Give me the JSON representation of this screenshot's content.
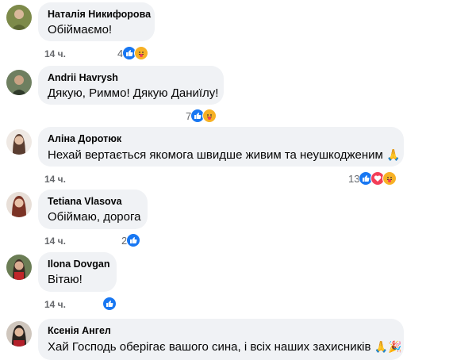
{
  "comments": [
    {
      "author": "Наталія Никифорова",
      "text": "Обіймаємо!",
      "time": "14 ч.",
      "reactions": "4",
      "avatar_color": "#9a8f5c"
    },
    {
      "author": "Andrii Havrysh",
      "text": "Дякую, Риммо! Дякую Даниїлу!",
      "time": "",
      "reactions": "7",
      "avatar_color": "#4a5a44"
    },
    {
      "author": "Аліна Доротюк",
      "text": "Нехай вертається якомога швидше живим та неушкодженим",
      "emoji": "🙏",
      "time": "14 ч.",
      "reactions": "13",
      "avatar_color": "#6b5346"
    },
    {
      "author": "Tetiana Vlasova",
      "text": "Обіймаю, дорога",
      "time": "14 ч.",
      "reactions": "2",
      "avatar_color": "#7a4d45"
    },
    {
      "author": "Ilona Dovgan",
      "text": "Вітаю!",
      "time": "14 ч.",
      "reactions": "",
      "avatar_color": "#8a3a3a"
    },
    {
      "author": "Ксенія Ангел",
      "text": "Хай Господь оберігає вашого сина, і всіх наших захисників",
      "emoji": "🙏🎉",
      "time": "",
      "reactions": "",
      "avatar_color": "#3f3a3a"
    }
  ],
  "colors": {
    "like": "#1877f2",
    "care": "#f7b125",
    "love": "#f33e58",
    "bubble": "#f0f2f5",
    "meta": "#65676b"
  },
  "icons": {
    "like": "thumbs-up-icon",
    "care": "care-hug-icon",
    "love": "heart-icon"
  }
}
